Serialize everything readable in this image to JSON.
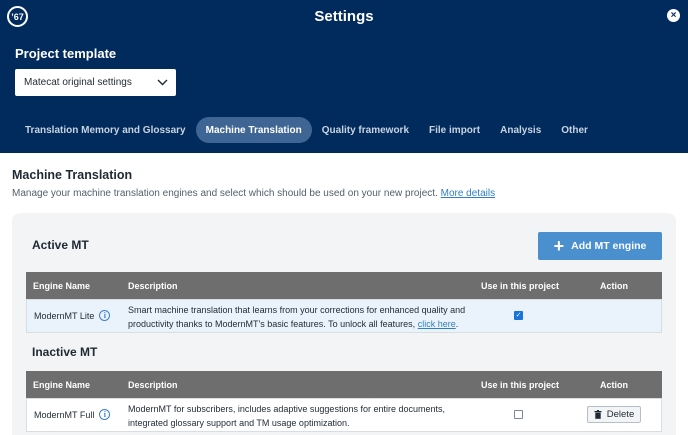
{
  "header": {
    "title": "Settings",
    "logo_glyph": "’67",
    "close_glyph": "×"
  },
  "project_template": {
    "label": "Project template",
    "selected": "Matecat original settings"
  },
  "tabs": [
    {
      "label": "Translation Memory and Glossary",
      "active": false
    },
    {
      "label": "Machine Translation",
      "active": true
    },
    {
      "label": "Quality framework",
      "active": false
    },
    {
      "label": "File import",
      "active": false
    },
    {
      "label": "Analysis",
      "active": false
    },
    {
      "label": "Other",
      "active": false
    }
  ],
  "section": {
    "title": "Machine Translation",
    "description": "Manage your machine translation engines and select which should be used on your new project.",
    "more_link": "More details"
  },
  "active_mt": {
    "title": "Active MT",
    "add_button": "Add MT engine",
    "columns": [
      "Engine Name",
      "Description",
      "Use in this project",
      "Action"
    ],
    "rows": [
      {
        "name": "ModernMT Lite",
        "desc_line1": "Smart machine translation that learns from your corrections for enhanced quality and",
        "desc_line2": "productivity thanks to ModernMT's basic features. To unlock all features,",
        "desc_link": "click here",
        "desc_end": ".",
        "use": true
      }
    ]
  },
  "inactive_mt": {
    "title": "Inactive MT",
    "columns": [
      "Engine Name",
      "Description",
      "Use in this project",
      "Action"
    ],
    "rows": [
      {
        "name": "ModernMT Full",
        "desc_line1": "ModernMT for subscribers, includes adaptive suggestions for entire documents,",
        "desc_line2": "integrated glossary support and TM usage optimization.",
        "use": false,
        "action": "Delete"
      }
    ]
  },
  "colors": {
    "header_bg": "#002b5c",
    "tab_active_bg": "#3f6594",
    "accent_button": "#4a8fce",
    "table_header_bg": "#6e6e6e",
    "highlight_row": "#eaf3fb",
    "link": "#2f7fc1"
  }
}
